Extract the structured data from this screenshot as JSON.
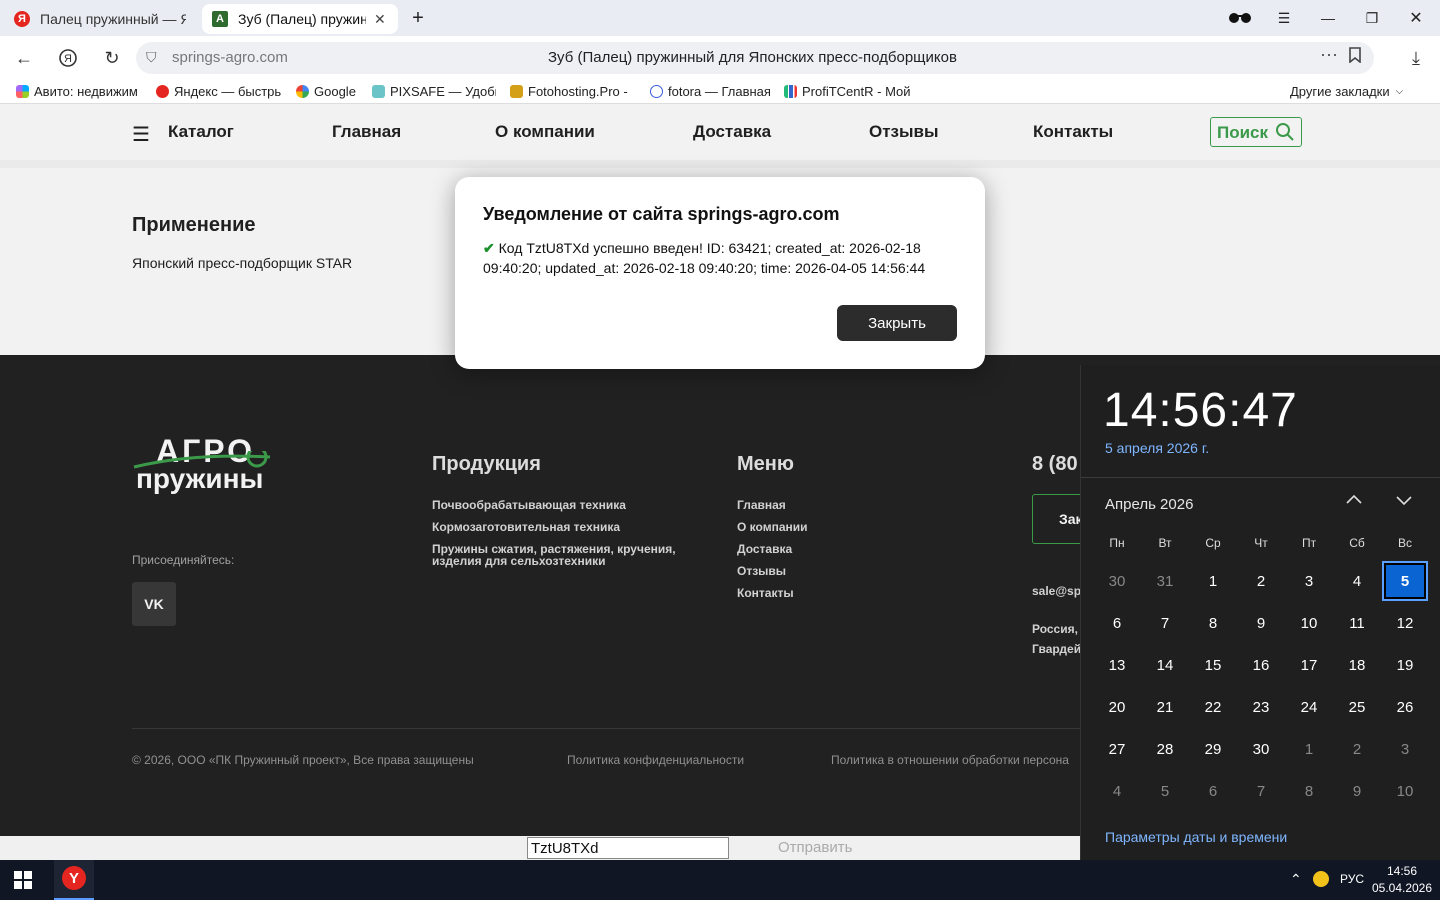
{
  "browser": {
    "tabs": [
      {
        "label": "Палец пружинный — Янд",
        "favicon": "yandex-icon",
        "active": false
      },
      {
        "label": "Зуб (Палец) пружинны",
        "favicon": "agro-favicon",
        "active": true
      }
    ],
    "url": "springs-agro.com",
    "page_title": "Зуб (Палец) пружинный для Японских пресс-подборщиков",
    "bookmarks": [
      {
        "label": "Авито: недвижим",
        "icon": "avito-icon"
      },
      {
        "label": "Яндекс — быстрь",
        "icon": "yandex-icon"
      },
      {
        "label": "Google",
        "icon": "google-icon"
      },
      {
        "label": "PIXSAFE — Удобн",
        "icon": "pixsafe-icon"
      },
      {
        "label": "Fotohosting.Pro -",
        "icon": "fotohosting-icon"
      },
      {
        "label": "fotora — Главная",
        "icon": "fotora-icon"
      },
      {
        "label": "ProfiTCentR - Мой",
        "icon": "chart-icon"
      }
    ],
    "other_bookmarks": "Другие закладки"
  },
  "site": {
    "nav": {
      "catalog": "Каталог",
      "items": [
        "Главная",
        "О компании",
        "Доставка",
        "Отзывы",
        "Контакты"
      ],
      "search": "Поиск"
    },
    "application": {
      "heading": "Применение",
      "text": "Японский пресс-подборщик STAR"
    },
    "footer": {
      "logo_top": "АГРО",
      "logo_bottom": "пружины",
      "join": "Присоединяйтесь:",
      "vk": "VK",
      "products_heading": "Продукция",
      "products": [
        "Почвообрабатывающая техника",
        "Кормозаготовительная техника",
        "Пружины сжатия, растяжения, кручения,",
        "изделия для сельхозтехники"
      ],
      "menu_heading": "Меню",
      "menu": [
        "Главная",
        "О компании",
        "Доставка",
        "Отзывы",
        "Контакты"
      ],
      "phone_partial": "8 (80",
      "order_btn_partial": "Зак",
      "email_partial": "sale@sp",
      "addr1_partial": "Россия, I",
      "addr2_partial": "Гвардей",
      "copyright": "© 2026, ООО «ПК Пружинный проект», Все права защищены",
      "privacy": "Политика конфиденциальности",
      "personal": "Политика в отношении обработки персона"
    },
    "form": {
      "code_value": "TztU8TXd",
      "send": "Отправить"
    }
  },
  "dialog": {
    "title": "Уведомление от сайта springs-agro.com",
    "message": "Код TztU8TXd успешно введен! ID: 63421; created_at: 2026-02-18 09:40:20; updated_at: 2026-02-18 09:40:20; time: 2026-04-05 14:56:44",
    "close": "Закрыть"
  },
  "calendar": {
    "time": "14:56:47",
    "long_date": "5 апреля 2026 г.",
    "month": "Апрель 2026",
    "weekdays": [
      "Пн",
      "Вт",
      "Ср",
      "Чт",
      "Пт",
      "Сб",
      "Вс"
    ],
    "weeks": [
      [
        "30",
        "31",
        "1",
        "2",
        "3",
        "4",
        "5"
      ],
      [
        "6",
        "7",
        "8",
        "9",
        "10",
        "11",
        "12"
      ],
      [
        "13",
        "14",
        "15",
        "16",
        "17",
        "18",
        "19"
      ],
      [
        "20",
        "21",
        "22",
        "23",
        "24",
        "25",
        "26"
      ],
      [
        "27",
        "28",
        "29",
        "30",
        "1",
        "2",
        "3"
      ],
      [
        "4",
        "5",
        "6",
        "7",
        "8",
        "9",
        "10"
      ]
    ],
    "today": "5",
    "settings": "Параметры даты и времени"
  },
  "taskbar": {
    "lang": "РУС",
    "time": "14:56",
    "date": "05.04.2026"
  }
}
